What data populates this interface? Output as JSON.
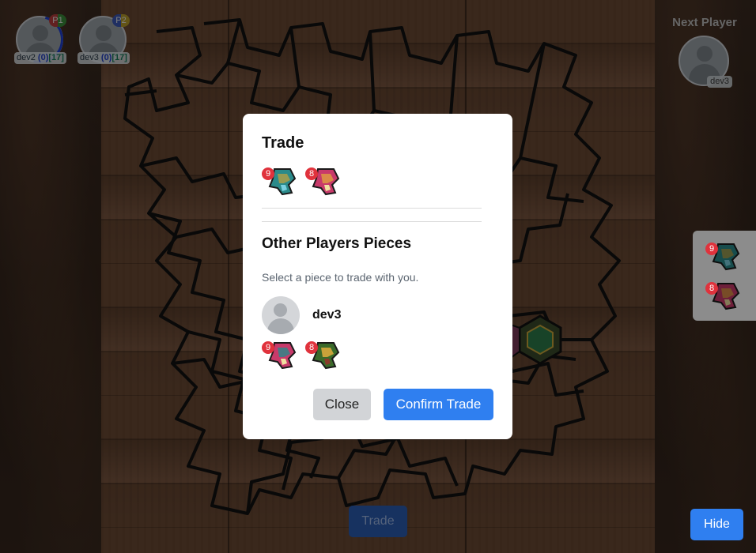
{
  "players": [
    {
      "badge": "P1",
      "name": "dev2",
      "score": "(0)",
      "pieces": "[17]"
    },
    {
      "badge": "P2",
      "name": "dev3",
      "score": "(0)",
      "pieces": "[17]"
    }
  ],
  "next_player": {
    "title": "Next Player",
    "name": "dev3"
  },
  "side_panel": {
    "pieces": [
      {
        "count": "9",
        "icon": "teal-hex-piece"
      },
      {
        "count": "8",
        "icon": "pink-hex-piece"
      }
    ]
  },
  "trade_button": "Trade",
  "hide_button": "Hide",
  "modal": {
    "title": "Trade",
    "my_pieces": [
      {
        "count": "9",
        "icon": "teal-hex-piece"
      },
      {
        "count": "8",
        "icon": "pink-hex-piece"
      }
    ],
    "others_title": "Other Players Pieces",
    "others_subtitle": "Select a piece to trade with you.",
    "other_player": {
      "name": "dev3",
      "pieces": [
        {
          "count": "9",
          "icon": "pink-hex-piece"
        },
        {
          "count": "8",
          "icon": "green-gold-hex-piece"
        }
      ]
    },
    "close_label": "Close",
    "confirm_label": "Confirm Trade"
  }
}
